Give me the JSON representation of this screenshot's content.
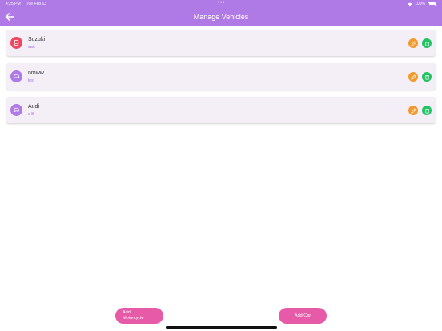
{
  "status_bar": {
    "time": "4:25 PM",
    "date": "Tue Feb 13",
    "dots": "•••",
    "battery": "100%"
  },
  "header": {
    "title": "Manage Vehicles"
  },
  "vehicles": [
    {
      "name": "Suzuki",
      "model": "swit",
      "type": "motorcycle",
      "icon_color": "#f0455c"
    },
    {
      "name": "nmww",
      "model": "test",
      "type": "car",
      "icon_color": "#b07ae6"
    },
    {
      "name": "Audi",
      "model": "a 8",
      "type": "car",
      "icon_color": "#b07ae6"
    }
  ],
  "buttons": {
    "add_motorcycle": "Add\nMotorcycle",
    "add_car": "Add Car"
  },
  "colors": {
    "header": "#b07ae6",
    "edit": "#f29a2e",
    "delete": "#22c365",
    "primary_button": "#e65aa8"
  }
}
